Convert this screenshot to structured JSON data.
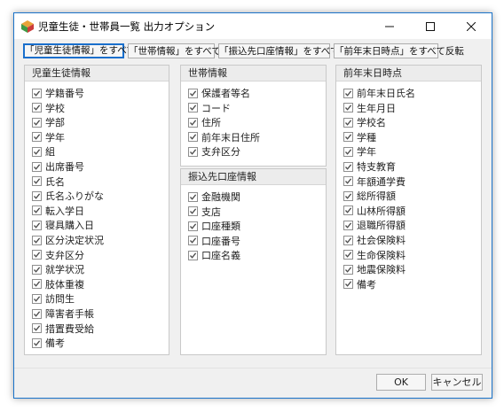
{
  "window": {
    "title": "児童生徒・世帯員一覧 出力オプション",
    "controls": {
      "minimize": "—",
      "maximize": "☐",
      "close": "✕"
    }
  },
  "toggle_buttons": [
    "「児童生徒情報」をすべて反転",
    "「世帯情報」をすべて反転",
    "「振込先口座情報」をすべて反転",
    "「前年末日時点」をすべて反転"
  ],
  "panels": {
    "student": {
      "title": "児童生徒情報",
      "items": [
        "学籍番号",
        "学校",
        "学部",
        "学年",
        "組",
        "出席番号",
        "氏名",
        "氏名ふりがな",
        "転入学日",
        "寝具購入日",
        "区分決定状況",
        "支弁区分",
        "就学状況",
        "肢体重複",
        "訪問生",
        "障害者手帳",
        "措置費受給",
        "備考"
      ]
    },
    "household": {
      "title": "世帯情報",
      "items": [
        "保護者等名",
        "コード",
        "住所",
        "前年末日住所",
        "支弁区分"
      ]
    },
    "account": {
      "title": "振込先口座情報",
      "items": [
        "金融機関",
        "支店",
        "口座種類",
        "口座番号",
        "口座名義"
      ]
    },
    "prev_year": {
      "title": "前年末日時点",
      "items": [
        "前年末日氏名",
        "生年月日",
        "学校名",
        "学種",
        "学年",
        "特支教育",
        "年額通学費",
        "総所得額",
        "山林所得額",
        "退職所得額",
        "社会保険料",
        "生命保険料",
        "地震保険料",
        "備考"
      ]
    }
  },
  "buttons": {
    "ok": "OK",
    "cancel": "キャンセル"
  },
  "colors": {
    "accent": "#1a73c9",
    "check": "#4a4a4a"
  }
}
